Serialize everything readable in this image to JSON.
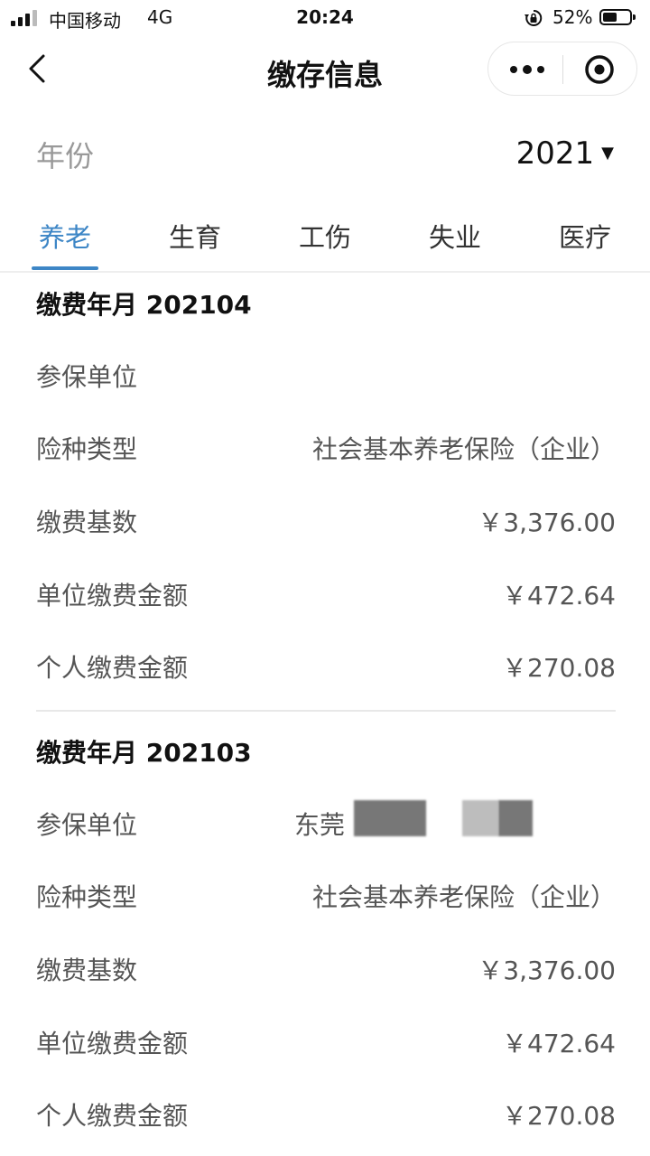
{
  "status_bar": {
    "carrier": "中国移动",
    "network": "4G",
    "time": "20:24",
    "battery": "52%",
    "battery_level": 0.52
  },
  "nav": {
    "title": "缴存信息",
    "icons": [
      "back-icon",
      "more-icon",
      "close-miniprogram-icon"
    ]
  },
  "year": {
    "label": "年份",
    "value": "2021"
  },
  "tabs": [
    {
      "label": "养老",
      "active": true
    },
    {
      "label": "生育",
      "active": false
    },
    {
      "label": "工伤",
      "active": false
    },
    {
      "label": "失业",
      "active": false
    },
    {
      "label": "医疗",
      "active": false
    }
  ],
  "records": [
    {
      "title": "缴费年月 202104",
      "rows": [
        {
          "label": "参保单位",
          "value": ""
        },
        {
          "label": "险种类型",
          "value": "社会基本养老保险（企业）"
        },
        {
          "label": "缴费基数",
          "value": "￥3,376.00"
        },
        {
          "label": "单位缴费金额",
          "value": "￥472.64"
        },
        {
          "label": "个人缴费金额",
          "value": "￥270.08"
        }
      ]
    },
    {
      "title": "缴费年月 202103",
      "rows": [
        {
          "label": "参保单位",
          "value": "东莞"
        },
        {
          "label": "险种类型",
          "value": "社会基本养老保险（企业）"
        },
        {
          "label": "缴费基数",
          "value": "￥3,376.00"
        },
        {
          "label": "单位缴费金额",
          "value": "￥472.64"
        },
        {
          "label": "个人缴费金额",
          "value": "￥270.08"
        }
      ]
    }
  ],
  "colors": {
    "accent": "#3d86c6",
    "label_gray": "#999999"
  }
}
